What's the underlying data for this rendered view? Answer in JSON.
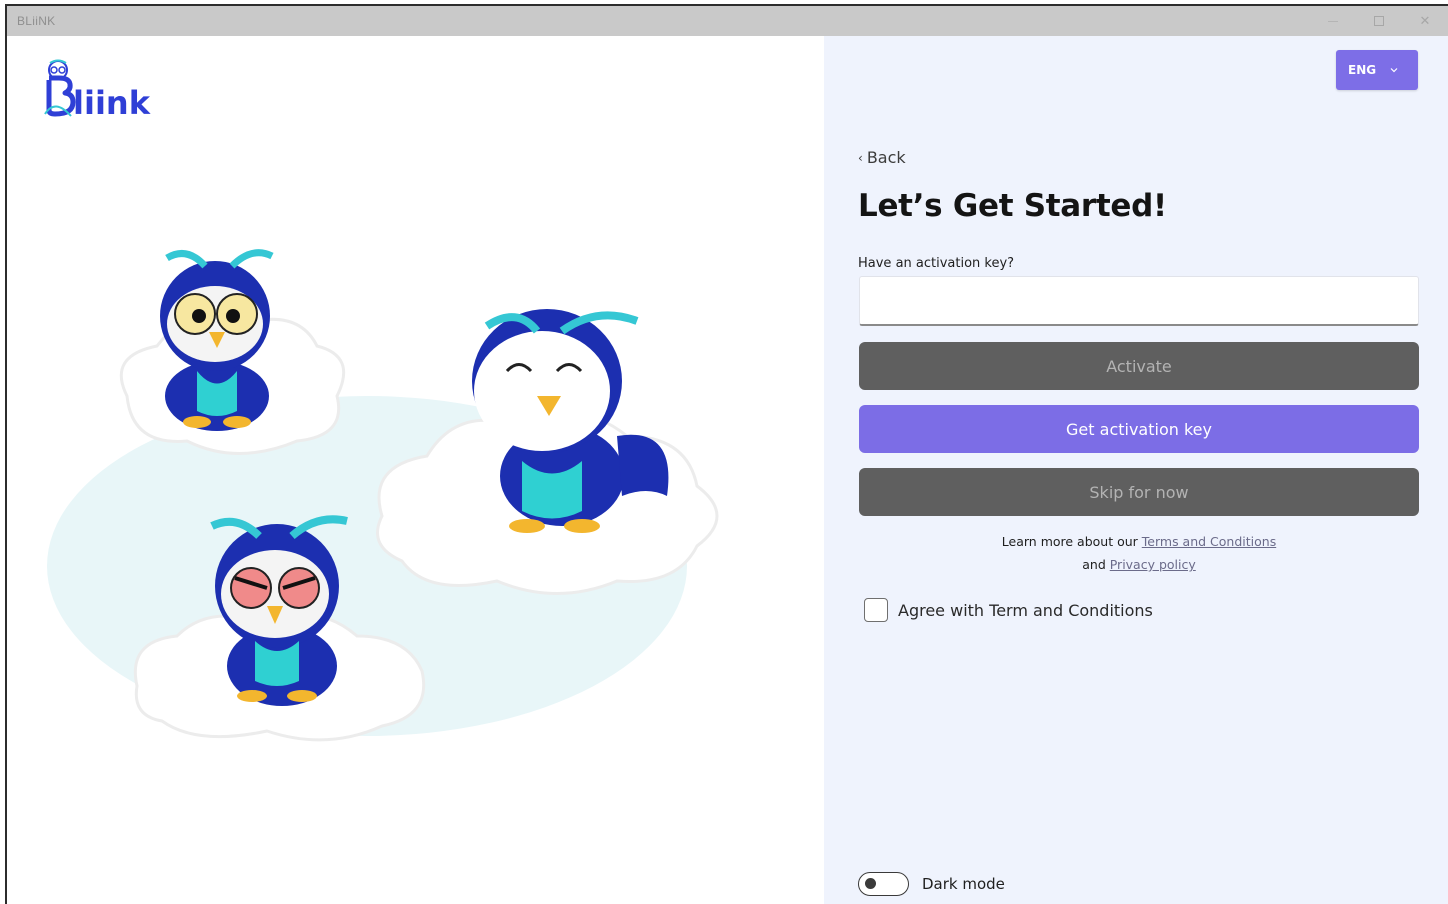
{
  "window": {
    "title": "BLiiNK"
  },
  "brand": {
    "logo_text": "Bliink",
    "primary_color": "#7c6de6",
    "logo_color": "#2f3fd6"
  },
  "language": {
    "selected": "ENG"
  },
  "nav": {
    "back_label": "Back"
  },
  "page": {
    "heading": "Let’s Get Started!"
  },
  "activation": {
    "label": "Have an activation key?",
    "value": "",
    "placeholder": ""
  },
  "buttons": {
    "activate": "Activate",
    "get_key": "Get activation key",
    "skip": "Skip for now"
  },
  "legal": {
    "line1_prefix": "Learn more about our ",
    "terms_link": "Terms and Conditions",
    "line2_prefix": "and ",
    "privacy_link": "Privacy policy"
  },
  "agreement": {
    "label": "Agree with Term and Conditions",
    "checked": false
  },
  "settings": {
    "dark_mode_label": "Dark mode",
    "dark_mode_on": false
  }
}
